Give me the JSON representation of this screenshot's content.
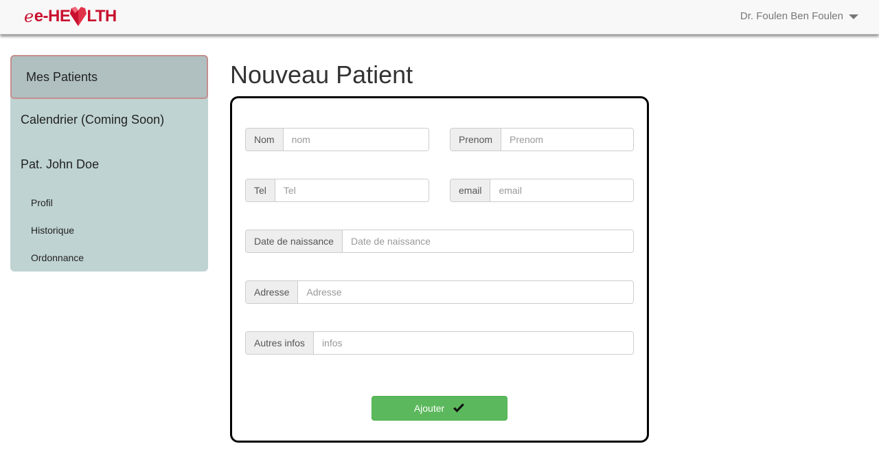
{
  "brand": {
    "logo_prefix": "e-HE",
    "logo_suffix": "LTH",
    "accent_color": "#c8102e"
  },
  "user_menu": {
    "label": "Dr. Foulen Ben Foulen"
  },
  "sidebar": {
    "active_item": "Mes Patients",
    "items": [
      {
        "label": "Calendrier (Coming Soon)"
      },
      {
        "label": "Pat. John Doe"
      }
    ],
    "sub_items": [
      {
        "label": "Profil"
      },
      {
        "label": "Historique"
      },
      {
        "label": "Ordonnance"
      }
    ]
  },
  "page": {
    "title": "Nouveau Patient"
  },
  "form": {
    "nom": {
      "label": "Nom",
      "placeholder": "nom"
    },
    "prenom": {
      "label": "Prenom",
      "placeholder": "Prenom"
    },
    "tel": {
      "label": "Tel",
      "placeholder": "Tel"
    },
    "email": {
      "label": "email",
      "placeholder": "email"
    },
    "dob": {
      "label": "Date de naissance",
      "placeholder": "Date de naissance"
    },
    "adresse": {
      "label": "Adresse",
      "placeholder": "Adresse"
    },
    "infos": {
      "label": "Autres infos",
      "placeholder": "infos"
    },
    "submit_label": "Ajouter",
    "submit_color": "#5cb85c"
  }
}
